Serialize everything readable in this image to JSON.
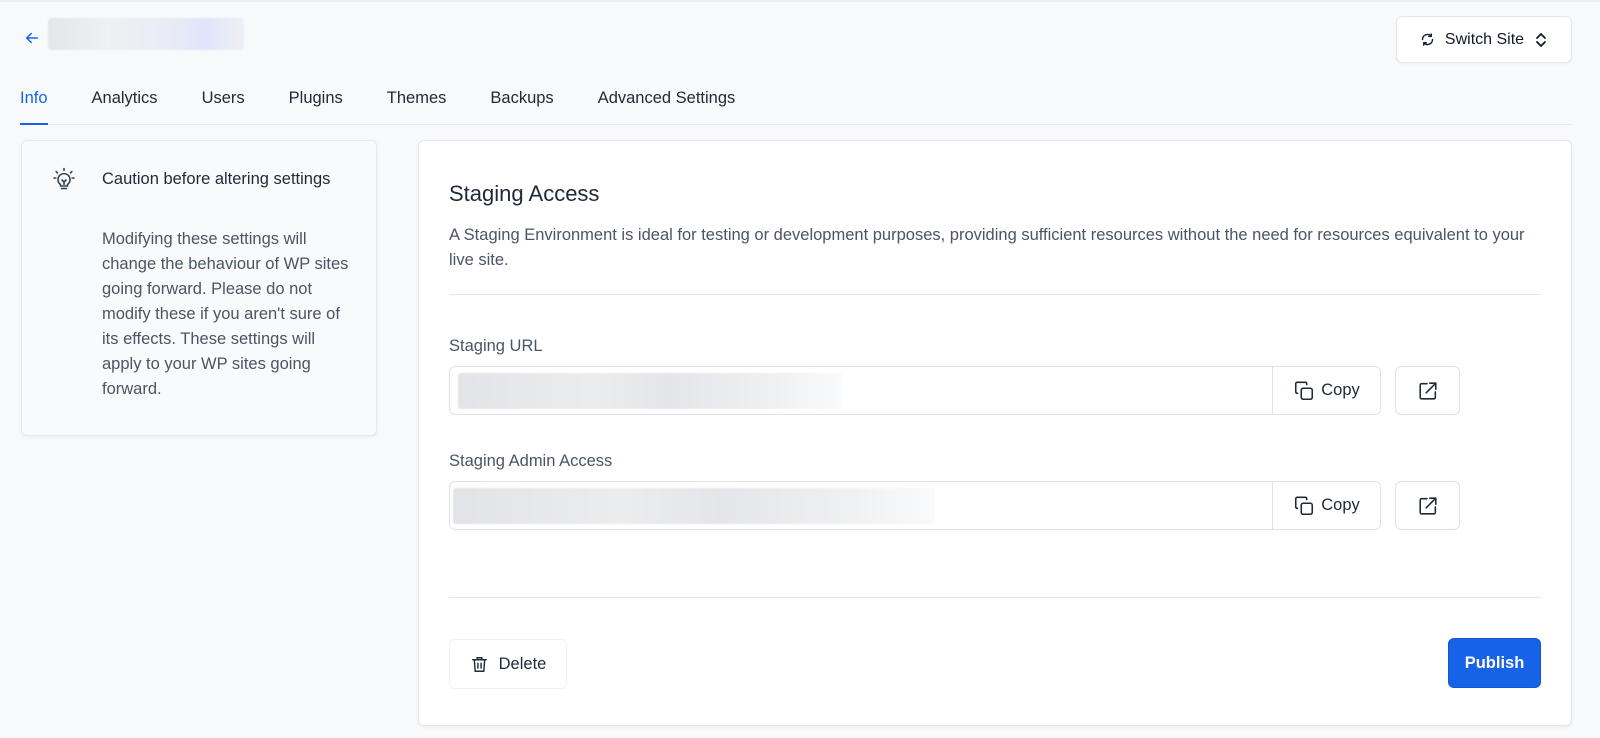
{
  "header": {
    "back_icon": "arrow-left-icon",
    "site_name": "",
    "switch_site_label": "Switch Site",
    "switch_icon": "refresh-icon",
    "switch_chevron_icon": "chevron-up-down-icon"
  },
  "tabs": [
    {
      "label": "Info",
      "active": true
    },
    {
      "label": "Analytics",
      "active": false
    },
    {
      "label": "Users",
      "active": false
    },
    {
      "label": "Plugins",
      "active": false
    },
    {
      "label": "Themes",
      "active": false
    },
    {
      "label": "Backups",
      "active": false
    },
    {
      "label": "Advanced Settings",
      "active": false
    }
  ],
  "caution": {
    "icon": "lightbulb-icon",
    "title": "Caution before altering settings",
    "body": "Modifying these settings will change the behaviour of WP sites going forward. Please do not modify these if you aren't sure of its effects. These settings will apply to your WP sites going forward."
  },
  "staging": {
    "title": "Staging Access",
    "description": "A Staging Environment is ideal for testing or development purposes, providing sufficient resources without the need for resources equivalent to your live site.",
    "url_label": "Staging URL",
    "url_value": "",
    "admin_label": "Staging Admin Access",
    "admin_value": "",
    "copy_label": "Copy",
    "copy_icon": "copy-icon",
    "open_icon": "external-link-icon",
    "delete_label": "Delete",
    "delete_icon": "trash-icon",
    "publish_label": "Publish"
  },
  "colors": {
    "accent": "#1763e8",
    "background": "#f8f9fb",
    "card": "#ffffff",
    "border": "#e5e7eb"
  }
}
